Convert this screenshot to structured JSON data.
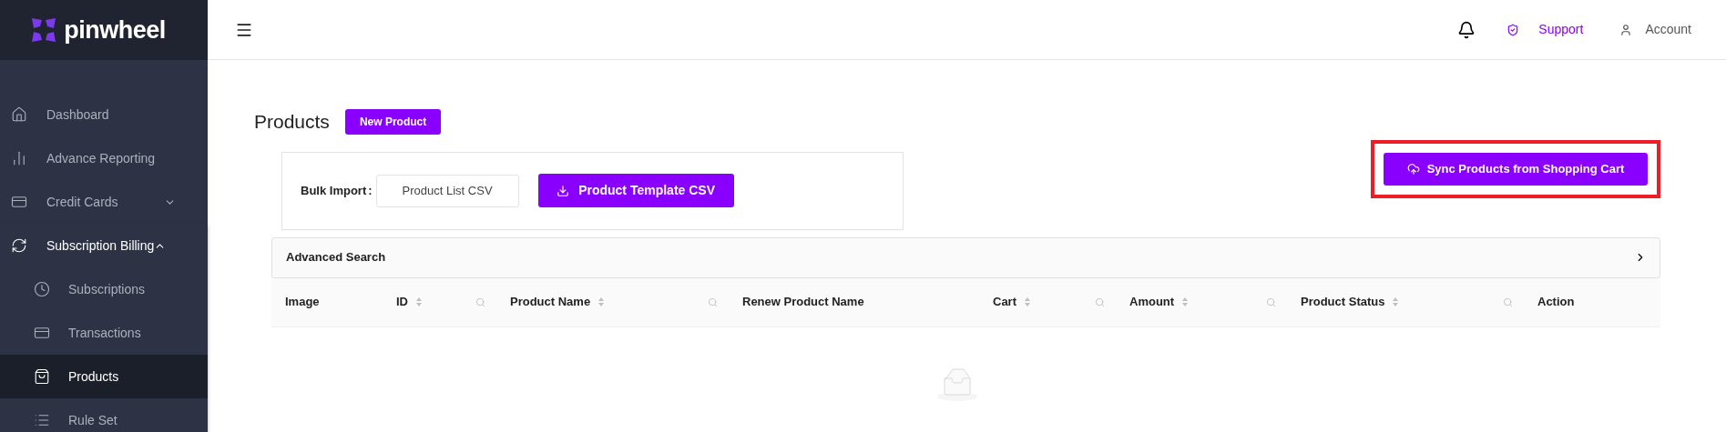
{
  "logo": {
    "text": "pinwheel"
  },
  "sidebar": {
    "items": [
      {
        "label": "Dashboard",
        "selected": false
      },
      {
        "label": "Advance Reporting",
        "selected": false
      },
      {
        "label": "Credit Cards",
        "selected": false,
        "expanded": false
      },
      {
        "label": "Subscription Billing",
        "selected": false,
        "expanded": true,
        "children": [
          {
            "label": "Subscriptions",
            "selected": false
          },
          {
            "label": "Transactions",
            "selected": false
          },
          {
            "label": "Products",
            "selected": true
          },
          {
            "label": "Rule Set",
            "selected": false
          }
        ]
      }
    ]
  },
  "topbar": {
    "support": "Support",
    "account": "Account"
  },
  "page": {
    "title": "Products",
    "new_button": "New Product",
    "bulk_import": {
      "label": "Bulk Import",
      "separator": ":",
      "file_button": "Product List CSV",
      "template_button": "Product Template CSV"
    },
    "sync_button": {
      "label": "Sync Products from Shopping Cart",
      "highlighted": true
    },
    "advanced_search": {
      "label": "Advanced Search",
      "expanded": false
    }
  },
  "table": {
    "columns": [
      {
        "label": "Image",
        "sortable": false,
        "searchable": false
      },
      {
        "label": "ID",
        "sortable": true,
        "searchable": true
      },
      {
        "label": "Product Name",
        "sortable": true,
        "searchable": true
      },
      {
        "label": "Renew Product Name",
        "sortable": false,
        "searchable": false
      },
      {
        "label": "Cart",
        "sortable": true,
        "searchable": true
      },
      {
        "label": "Amount",
        "sortable": true,
        "searchable": true
      },
      {
        "label": "Product Status",
        "sortable": true,
        "searchable": true
      },
      {
        "label": "Action",
        "sortable": false,
        "searchable": false
      }
    ],
    "empty": true
  }
}
